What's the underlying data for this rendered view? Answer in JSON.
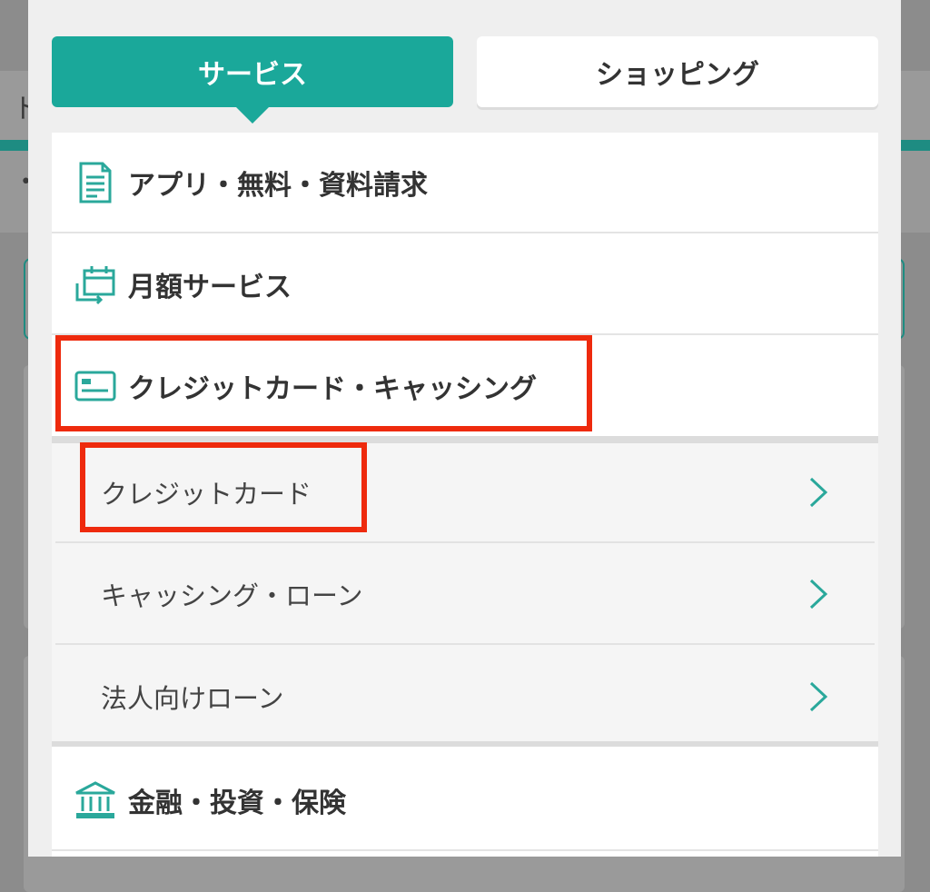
{
  "background": {
    "header_fragment": "ト",
    "subrow_fragment": "•"
  },
  "tabs": {
    "service": "サービス",
    "shopping": "ショッピング"
  },
  "categories": {
    "apps": "アプリ・無料・資料請求",
    "monthly": "月額サービス",
    "credit": "クレジットカード・キャッシング",
    "finance": "金融・投資・保険"
  },
  "subitems": [
    {
      "label": "クレジットカード"
    },
    {
      "label": "キャッシング・ローン"
    },
    {
      "label": "法人向けローン"
    }
  ],
  "colors": {
    "accent": "#1aa89a",
    "highlight": "#ee2a0d",
    "icon": "#2aa89b"
  },
  "icons": {
    "apps": "document-icon",
    "monthly": "calendar-cycle-icon",
    "credit": "credit-card-icon",
    "finance": "bank-icon",
    "subitem": "chevron-right-icon"
  }
}
